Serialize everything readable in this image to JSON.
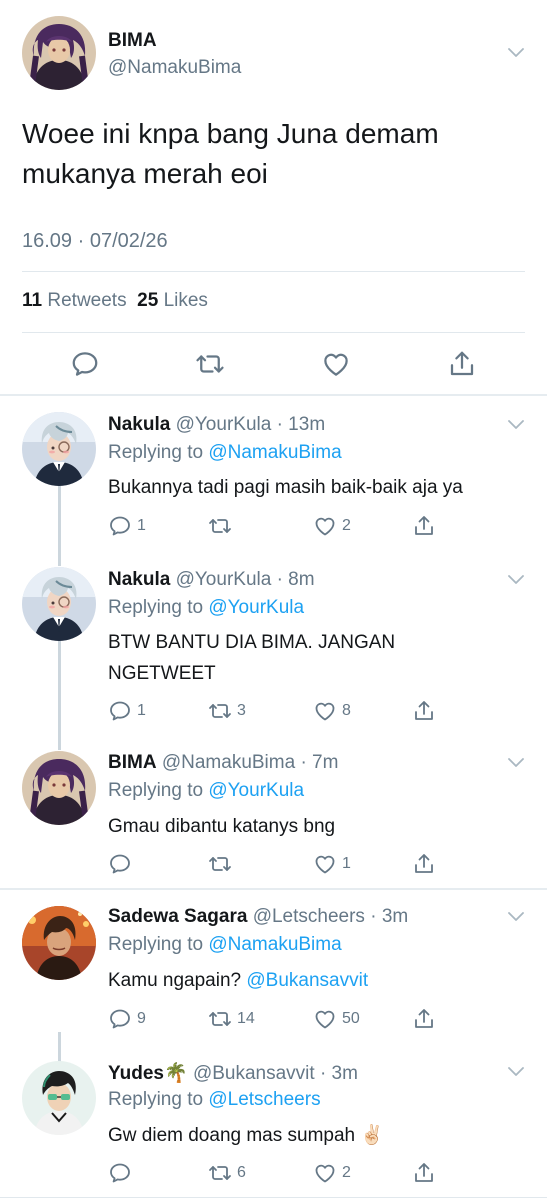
{
  "main": {
    "name": "BIMA",
    "handle": "@NamakuBima",
    "text": "Woee ini knpa bang Juna demam mukanya merah eoi",
    "timestamp": "16.09 · 07/02/26",
    "retweets_count": "11",
    "retweets_label": "Retweets",
    "likes_count": "25",
    "likes_label": "Likes"
  },
  "replies": [
    {
      "name": "Nakula",
      "handle": "@YourKula · 13m",
      "replying_label": "Replying to",
      "replying_to": "@NamakuBima",
      "text": "Bukannya tadi pagi masih baik-baik aja ya",
      "reply_count": "1",
      "retweet_count": "",
      "like_count": "2"
    },
    {
      "name": "Nakula",
      "handle": "@YourKula · 8m",
      "replying_label": "Replying to",
      "replying_to": "@YourKula",
      "text": "BTW BANTU DIA BIMA. JANGAN NGETWEET",
      "reply_count": "1",
      "retweet_count": "3",
      "like_count": "8"
    },
    {
      "name": "BIMA",
      "handle": "@NamakuBima · 7m",
      "replying_label": "Replying to",
      "replying_to": "@YourKula",
      "text": "Gmau dibantu katanys bng",
      "reply_count": "",
      "retweet_count": "",
      "like_count": "1"
    },
    {
      "name": "Sadewa Sagara",
      "handle": "@Letscheers · 3m",
      "replying_label": "Replying to",
      "replying_to": "@NamakuBima",
      "text": "Kamu ngapain?",
      "mention": "@Bukansavvit",
      "reply_count": "9",
      "retweet_count": "14",
      "like_count": "50"
    },
    {
      "name": "Yudes",
      "name_emoji": "🌴",
      "handle": "@Bukansavvit · 3m",
      "replying_label": "Replying to",
      "replying_to": "@Letscheers",
      "text": "Gw diem doang mas sumpah",
      "text_emoji": "✌🏻",
      "reply_count": "",
      "retweet_count": "6",
      "like_count": "2"
    }
  ],
  "colors": {
    "text": "#14171a",
    "secondary": "#657786",
    "link": "#1da1f2",
    "divider": "#e1e8ed",
    "thread_line": "#ccd6dd"
  },
  "icons": [
    "reply-icon",
    "retweet-icon",
    "like-icon",
    "share-icon",
    "chevron-down-icon"
  ]
}
